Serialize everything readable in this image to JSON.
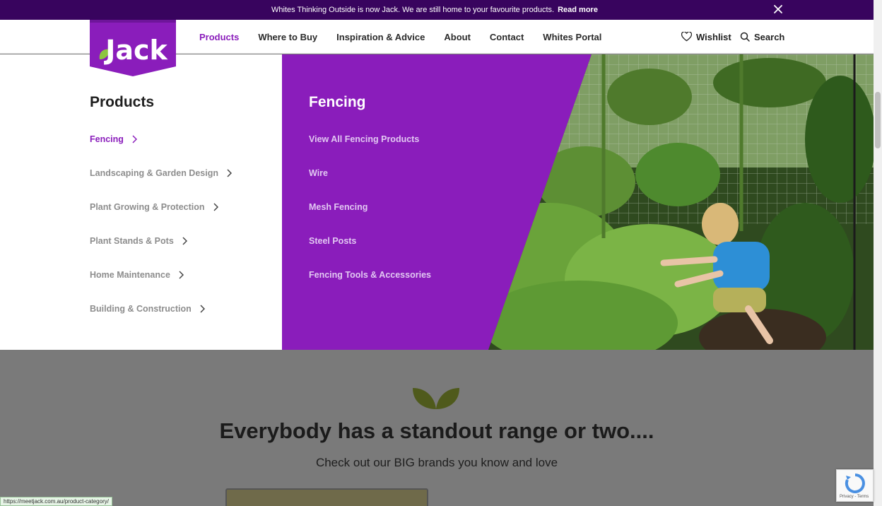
{
  "announcement": {
    "message": "Whites Thinking Outside is now Jack. We are still home to your favourite products.",
    "link": "Read more"
  },
  "brand": {
    "logo_text": "Jack",
    "purple": "#8a1dbb",
    "dark_purple": "#38045e",
    "leaf_green": "#8cc63f"
  },
  "nav": {
    "items": [
      "Products",
      "Where to Buy",
      "Inspiration & Advice",
      "About",
      "Contact",
      "Whites Portal"
    ],
    "active": "Products",
    "wishlist": "Wishlist",
    "search": "Search"
  },
  "menu": {
    "title": "Products",
    "categories": [
      "Fencing",
      "Landscaping & Garden Design",
      "Plant Growing & Protection",
      "Plant Stands & Pots",
      "Home Maintenance",
      "Building & Construction"
    ],
    "active_category": "Fencing",
    "sub_title": "Fencing",
    "sub_items": [
      "View All Fencing Products",
      "Wire",
      "Mesh Fencing",
      "Steel Posts",
      "Fencing Tools & Accessories"
    ]
  },
  "section": {
    "heading": "Everybody has a standout range or two....",
    "subheading": "Check out our BIG brands you know and love"
  },
  "status_url": "https://meetjack.com.au/product-category/",
  "recaptcha": {
    "links": "Privacy - Terms"
  }
}
